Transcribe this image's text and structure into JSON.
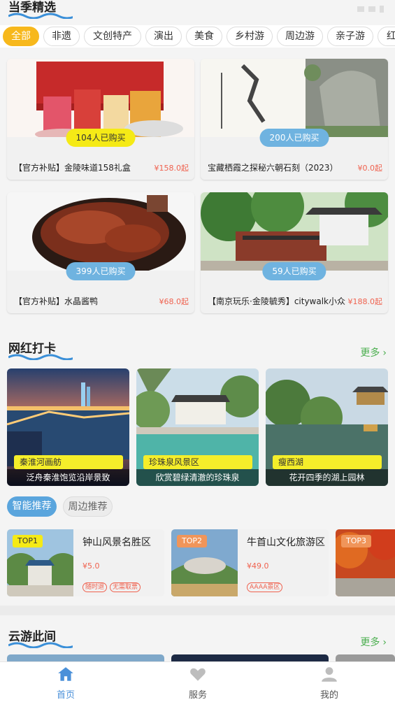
{
  "sections": {
    "seasonal": "当季精选",
    "hot": "网红打卡",
    "cloud": "云游此间",
    "more": "更多"
  },
  "categories": [
    "全部",
    "非遗",
    "文创特产",
    "演出",
    "美食",
    "乡村游",
    "周边游",
    "亲子游",
    "红"
  ],
  "products": [
    {
      "bought": "104人已购买",
      "title": "【官方补贴】金陵味道158礼盒",
      "price": "¥158.0",
      "unit": "起",
      "badge_color": "#f5ea16"
    },
    {
      "bought": "200人已购买",
      "title": "宝藏栖霞之探秘六朝石刻（2023）",
      "price": "¥0.0",
      "unit": "起",
      "badge_color": "#6fb3e0"
    },
    {
      "bought": "399人已购买",
      "title": "【官方补贴】水晶酱鸭",
      "price": "¥68.0",
      "unit": "起",
      "badge_color": "#6fb3e0"
    },
    {
      "bought": "59人已购买",
      "title": "【南京玩乐·金陵毓秀】citywalk小众",
      "price": "¥188.0",
      "unit": "起",
      "badge_color": "#6fb3e0"
    }
  ],
  "hot_spots": [
    {
      "tag": "秦淮河画舫",
      "desc": "泛舟秦淮饱览沿岸景致"
    },
    {
      "tag": "珍珠泉风景区",
      "desc": "欣赏碧绿清澈的珍珠泉"
    },
    {
      "tag": "瘦西湖",
      "desc": "花开四季的湖上园林"
    }
  ],
  "rec_tabs": [
    "智能推荐",
    "周边推荐"
  ],
  "top_list": [
    {
      "badge": "TOP1",
      "name": "钟山风景名胜区",
      "price": "¥5.0",
      "tags": [
        "随时退",
        "无需取票"
      ]
    },
    {
      "badge": "TOP2",
      "name": "牛首山文化旅游区",
      "price": "¥49.0",
      "tags": [
        "AAAA景区"
      ]
    },
    {
      "badge": "TOP3",
      "name": "",
      "price": "",
      "tags": []
    }
  ],
  "nav": [
    {
      "label": "首页",
      "icon": "home-icon",
      "active": true
    },
    {
      "label": "服务",
      "icon": "heart-icon",
      "active": false
    },
    {
      "label": "我的",
      "icon": "user-icon",
      "active": false
    }
  ],
  "colors": {
    "accent_yellow": "#f7b81c",
    "accent_blue": "#5aa5dd",
    "price_red": "#f0624f",
    "more_green": "#4caf50",
    "tag_yellow": "#f5ee2a",
    "nav_active": "#4a90d9"
  }
}
